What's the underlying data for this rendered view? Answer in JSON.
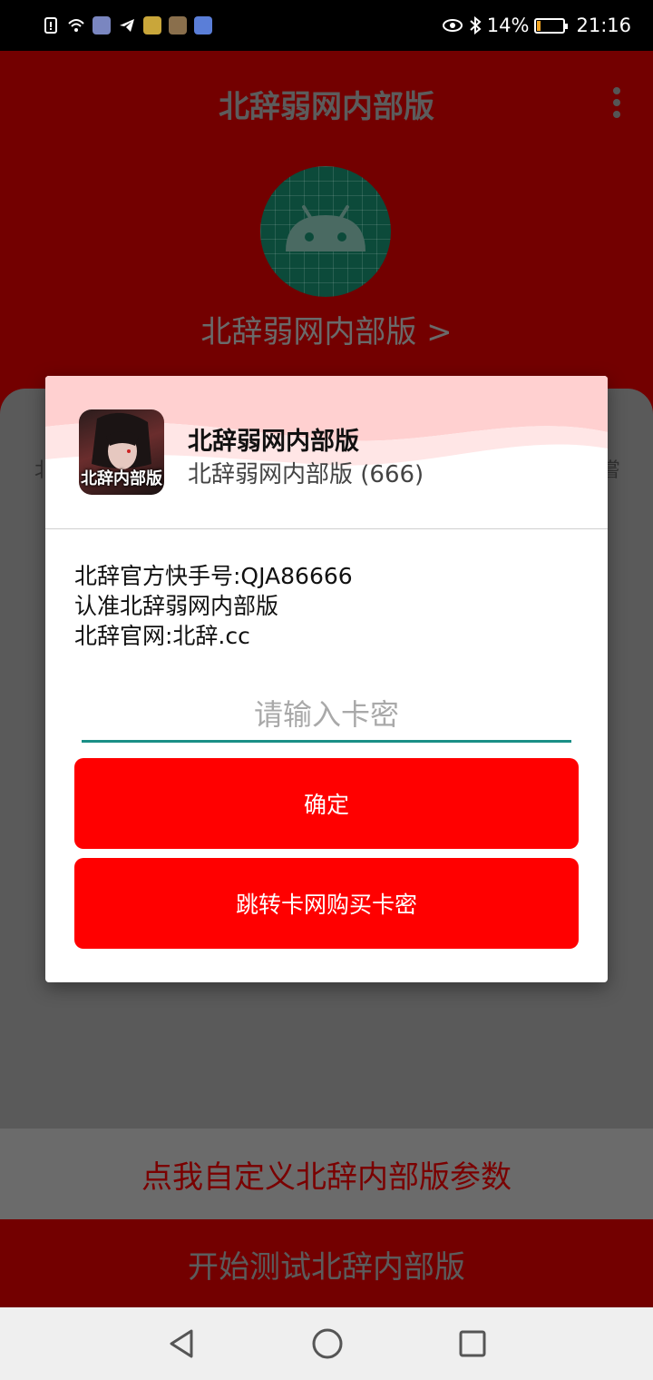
{
  "status_bar": {
    "icons": [
      "sim-alert-icon",
      "wifi-icon",
      "app-notification-icon",
      "telegram-icon",
      "video-app-icon",
      "game-app-icon",
      "music-app-icon"
    ],
    "right_icons": [
      "eye-icon",
      "bluetooth-icon"
    ],
    "battery_text": "14%",
    "battery_level": 0.14,
    "time": "21:16"
  },
  "app": {
    "title": "北辞弱网内部版",
    "app_label": "北辞弱网内部版 >",
    "sheet_edge_left": "北",
    "sheet_edge_right": "嘗",
    "custom_button": "点我自定义北辞内部版参数",
    "start_button": "开始测试北辞内部版"
  },
  "dialog": {
    "title": "北辞弱网内部版",
    "subtitle": "北辞弱网内部版 (666)",
    "avatar_text": "北辞内部版",
    "body_lines": [
      "北辞官方快手号:QJA86666",
      "认准北辞弱网内部版",
      "北辞官网:北辞.cc"
    ],
    "input_placeholder": "请输入卡密",
    "confirm_button": "确定",
    "buy_button": "跳转卡网购买卡密"
  },
  "colors": {
    "accent_red": "#ff0000",
    "dim_red": "#730000",
    "input_underline": "#1a8f86"
  },
  "navigation": {
    "icons": [
      "back-icon",
      "home-icon",
      "recents-icon"
    ]
  }
}
